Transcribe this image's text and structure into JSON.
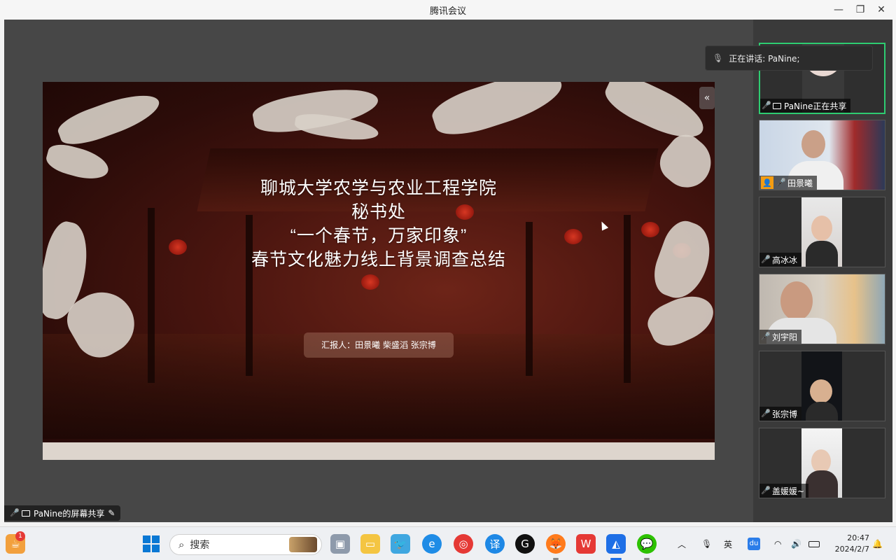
{
  "window": {
    "title": "腾讯会议",
    "minimize_icon": "—",
    "restore_icon": "❐",
    "close_icon": "✕"
  },
  "slide": {
    "line1": "聊城大学农学与农业工程学院",
    "line2": "秘书处",
    "line3": "“一个春节，万家印象”",
    "line4": "春节文化魅力线上背景调查总结",
    "reporter": "汇报人：田景曦  柴盛滔  张宗博",
    "collapse_icon": "«"
  },
  "share_badge": {
    "label": "PaNine的屏幕共享"
  },
  "speaking": {
    "label": "正在讲话:   PaNine;"
  },
  "participants": [
    {
      "name": "PaNine正在共享",
      "mic": "on",
      "sharing": true
    },
    {
      "name": "田景曦",
      "mic": "on",
      "avatar_tag": true
    },
    {
      "name": "高冰冰",
      "mic": "muted"
    },
    {
      "name": "刘宇阳",
      "mic": "muted"
    },
    {
      "name": "张宗博",
      "mic": "muted"
    },
    {
      "name": "盖媛媛~",
      "mic": "muted"
    }
  ],
  "taskbar": {
    "search_placeholder": "搜索",
    "notification_count": "1",
    "ime_label": "英",
    "time": "20:47",
    "date": "2024/2/7"
  }
}
